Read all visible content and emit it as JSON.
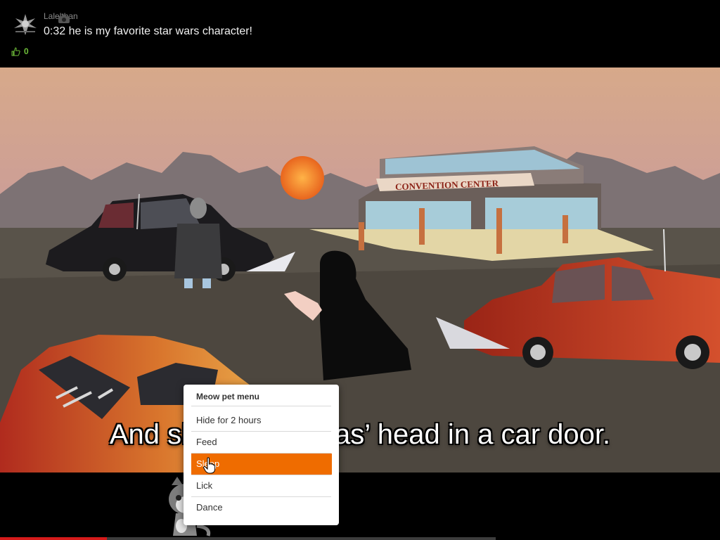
{
  "comment": {
    "author": "Lalelthan",
    "text": "0:32 he is my favorite star wars character!",
    "likes": "0",
    "icons": {
      "avatar": "winged-emblem-avatar",
      "like": "thumbs-up-icon"
    }
  },
  "video": {
    "sign_text": "CONVENTION CENTER",
    "subtitle": "And slammed Lucas’ head in a car door.",
    "progress": 0.215,
    "colors": {
      "progress": "#d51a1a",
      "sky_top": "#d7a98a",
      "sky_bottom": "#c99b9a"
    }
  },
  "pet_menu": {
    "title": "Meow pet menu",
    "items": [
      {
        "label": "Hide for 2 hours"
      },
      {
        "label": "Feed"
      },
      {
        "label": "Sleep"
      },
      {
        "label": "Lick"
      },
      {
        "label": "Dance"
      }
    ],
    "highlighted_index": 2,
    "highlight_color": "#ef6c00"
  }
}
